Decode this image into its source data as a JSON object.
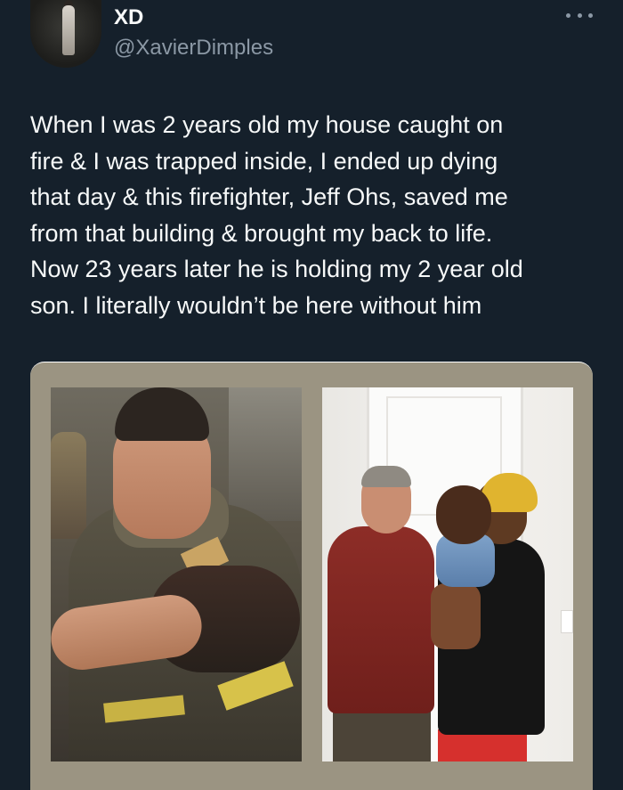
{
  "author": {
    "display_name": "XD",
    "handle": "@XavierDimples",
    "avatar": "avatar-photo"
  },
  "menu": {
    "icon": "more-horizontal-icon"
  },
  "tweet": {
    "lines": [
      "When I was 2 years old my house caught on",
      "fire & I was trapped inside, I ended up dying",
      "that day & this firefighter, Jeff Ohs, saved me",
      "from that building & brought my back to life.",
      "Now 23 years later he is holding my 2 year old",
      "son. I literally wouldn’t be here without him"
    ]
  },
  "media": {
    "photos": [
      "firefighter-rescue-photo",
      "reunion-photo"
    ]
  },
  "colors": {
    "background": "#15202b",
    "text": "#f7f9f9",
    "secondary_text": "#8b98a5",
    "media_frame": "#9b9482"
  }
}
